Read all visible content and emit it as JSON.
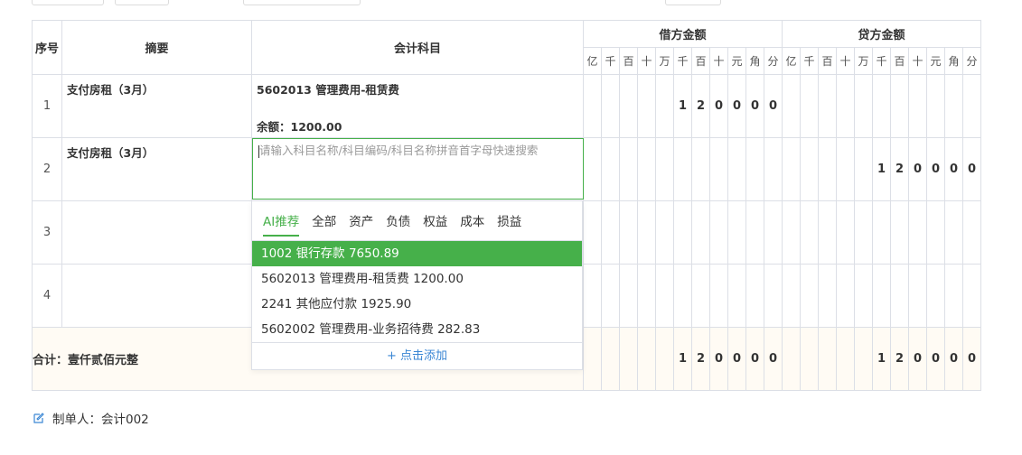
{
  "headers": {
    "index": "序号",
    "summary": "摘要",
    "account": "会计科目",
    "debit": "借方金额",
    "credit": "贷方金额",
    "units": [
      "亿",
      "千",
      "百",
      "十",
      "万",
      "千",
      "百",
      "十",
      "元",
      "角",
      "分"
    ]
  },
  "rows": [
    {
      "index": "1",
      "summary": "支付房租（3月）",
      "account": "5602013 管理费用-租赁费",
      "balance": "余额：1200.00",
      "debit": [
        "",
        "",
        "",
        "",
        "",
        "1",
        "2",
        "0",
        "0",
        "0",
        "0"
      ],
      "credit": [
        "",
        "",
        "",
        "",
        "",
        "",
        "",
        "",
        "",
        "",
        ""
      ]
    },
    {
      "index": "2",
      "summary": "支付房租（3月）",
      "account": "",
      "balance": "",
      "debit": [
        "",
        "",
        "",
        "",
        "",
        "",
        "",
        "",
        "",
        "",
        ""
      ],
      "credit": [
        "",
        "",
        "",
        "",
        "",
        "1",
        "2",
        "0",
        "0",
        "0",
        "0"
      ]
    },
    {
      "index": "3",
      "summary": "",
      "account": "",
      "balance": "",
      "debit": [
        "",
        "",
        "",
        "",
        "",
        "",
        "",
        "",
        "",
        "",
        ""
      ],
      "credit": [
        "",
        "",
        "",
        "",
        "",
        "",
        "",
        "",
        "",
        "",
        ""
      ]
    },
    {
      "index": "4",
      "summary": "",
      "account": "",
      "balance": "",
      "debit": [
        "",
        "",
        "",
        "",
        "",
        "",
        "",
        "",
        "",
        "",
        ""
      ],
      "credit": [
        "",
        "",
        "",
        "",
        "",
        "",
        "",
        "",
        "",
        "",
        ""
      ]
    }
  ],
  "total": {
    "label": "合计：壹仟贰佰元整",
    "debit": [
      "",
      "",
      "",
      "",
      "",
      "1",
      "2",
      "0",
      "0",
      "0",
      "0"
    ],
    "credit": [
      "",
      "",
      "",
      "",
      "",
      "1",
      "2",
      "0",
      "0",
      "0",
      "0"
    ]
  },
  "account_search": {
    "placeholder": "请输入科目名称/科目编码/科目名称拼音首字母快速搜索"
  },
  "dropdown": {
    "tabs": [
      "AI推荐",
      "全部",
      "资产",
      "负债",
      "权益",
      "成本",
      "损益"
    ],
    "options": [
      "1002 银行存款 7650.89",
      "5602013 管理费用-租赁费 1200.00",
      "2241 其他应付款 1925.90",
      "5602002 管理费用-业务招待费 282.83"
    ],
    "add_label": "+ 点击添加"
  },
  "maker": {
    "icon": "edit-icon",
    "text": "制单人：会计002"
  },
  "colors": {
    "accent": "#46b04a",
    "link": "#3a86d4",
    "total_bg": "#fffbf4"
  }
}
